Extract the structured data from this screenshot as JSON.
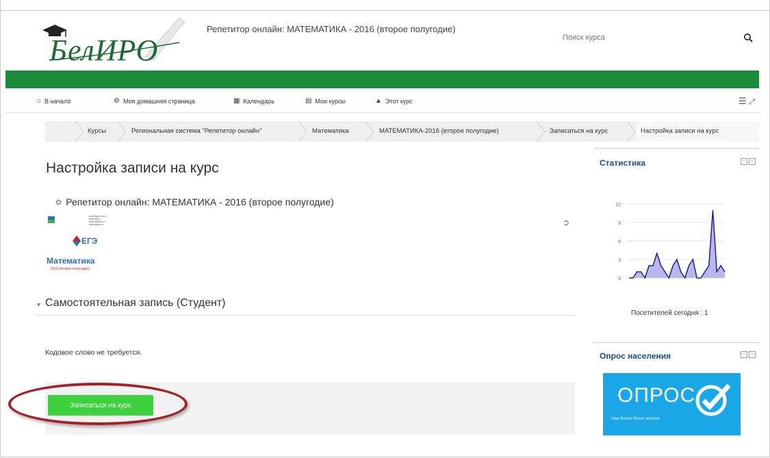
{
  "header": {
    "logo_text": "БелИРО",
    "site_title": "Репетитор онлайн: МАТЕМАТИКА - 2016 (второе полугодие)",
    "search_placeholder": "Поиск курса"
  },
  "nav": {
    "home": "В начало",
    "dashboard": "Моя домашняя страница",
    "calendar": "Календарь",
    "my_courses": "Мои курсы",
    "this_course": "Этот курс"
  },
  "breadcrumb": {
    "items": [
      "Курсы",
      "Региональная система \"Репетитор онлайн\"",
      "Математика",
      "МАТЕМАТИКА-2016 (второе полугодие)",
      "Записаться на курс",
      "Настройка записи на курс"
    ]
  },
  "main": {
    "page_title": "Настройка записи на курс",
    "course_name": "Репетитор онлайн: МАТЕМАТИКА - 2016 (второе полугодие)",
    "course_image": {
      "sites": [
        "www.ege.edu.ru",
        "www.fipi.ru",
        "www.beluno.ru",
        "www.ipkpp.ru"
      ],
      "label_ege": "ЕГЭ",
      "label_subject": "Математика",
      "label_year": "2016 (второе полугодие)"
    },
    "section_title": "Самостоятельная запись (Студент)",
    "no_key_text": "Кодовое слово не требуется.",
    "enrol_button": "Записаться на курс"
  },
  "stats_block": {
    "title": "Статистика",
    "visitors_text": "Посетителей сегодня : 1",
    "chart_data": {
      "type": "area",
      "y_ticks": [
        "12",
        "9",
        "6",
        "3",
        "0"
      ],
      "ylim": [
        0,
        12
      ],
      "values": [
        0,
        0,
        1,
        1,
        0,
        2,
        2,
        4,
        2,
        1,
        0,
        2,
        3,
        1,
        0,
        2,
        3,
        0,
        0,
        1,
        2,
        11,
        1,
        2,
        1
      ]
    }
  },
  "survey_block": {
    "title": "Опрос населения",
    "banner_title": "ОПРОС",
    "banner_subtitle": "Нам Важно Ваше мнение"
  },
  "colors": {
    "green_bar": "#1a8a3c",
    "button_green": "#3dd13d",
    "oval_red": "#a61f28",
    "survey_blue": "#1aa7e8",
    "block_title": "#1e4f7a"
  }
}
